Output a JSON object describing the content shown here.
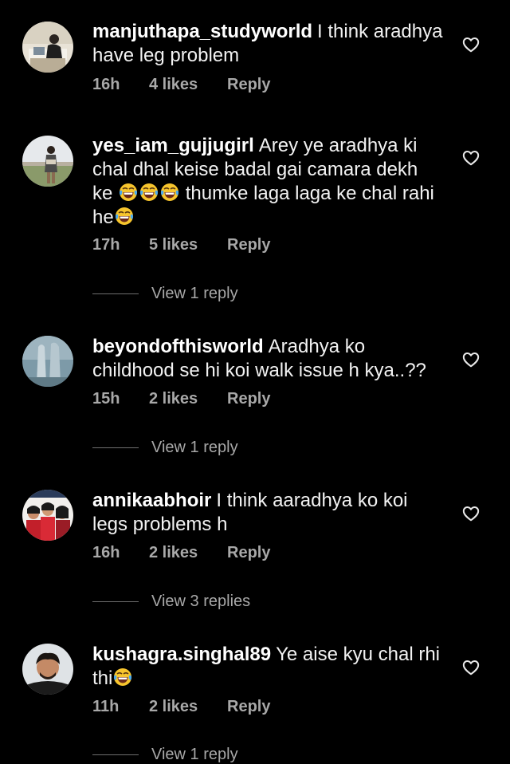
{
  "comments": [
    {
      "username": "manjuthapa_studyworld",
      "text": "I think aradhya have leg problem",
      "time": "16h",
      "likes": "4 likes",
      "reply": "Reply"
    },
    {
      "username": "yes_iam_gujjugirl",
      "text_a": "Arey ye aradhya ki chal dhal keise badal gai camara dekh ke",
      "text_b": "thumke laga laga ke chal rahi he",
      "emoji_name": "face-with-tears-of-joy-icon",
      "time": "17h",
      "likes": "5 likes",
      "reply": "Reply",
      "view_replies": "View 1 reply"
    },
    {
      "username": "beyondofthisworld",
      "text": "Aradhya ko childhood se hi koi walk issue h kya..??",
      "time": "15h",
      "likes": "2 likes",
      "reply": "Reply",
      "view_replies": "View 1 reply"
    },
    {
      "username": "annikaabhoir",
      "text": "I think aaradhya ko koi legs problems h",
      "time": "16h",
      "likes": "2 likes",
      "reply": "Reply",
      "view_replies": "View 3 replies"
    },
    {
      "username": "kushagra.singhal89",
      "text": "Ye aise kyu chal rhi thi",
      "emoji_name": "face-with-tears-of-joy-icon",
      "time": "11h",
      "likes": "2 likes",
      "reply": "Reply",
      "view_replies": "View 1 reply"
    }
  ],
  "colors": {
    "background": "#000000",
    "text": "#f2f2f2",
    "secondary": "#a8a8a8",
    "emoji_face": "#f7c52d"
  },
  "icons": {
    "like": "heart-outline-icon",
    "avatar": "avatar"
  }
}
